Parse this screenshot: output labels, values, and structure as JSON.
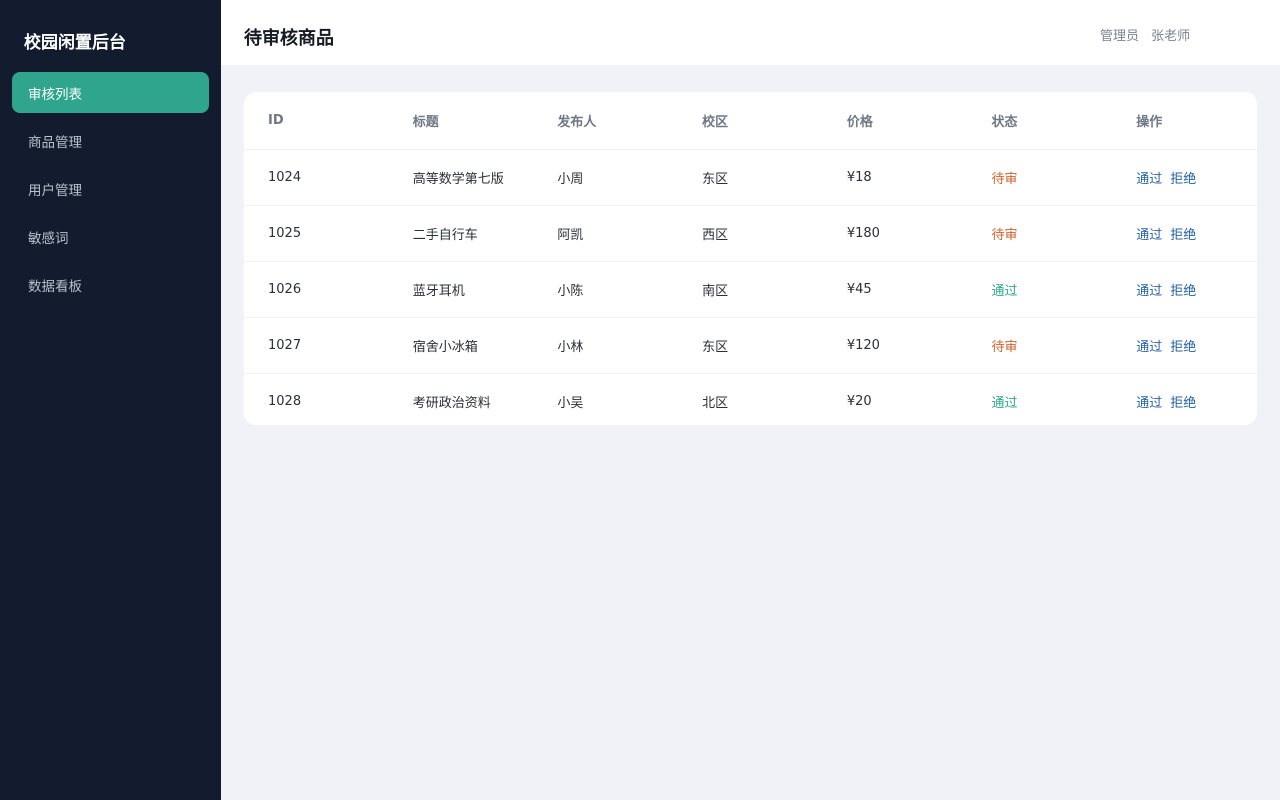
{
  "sidebar": {
    "brand": "校园闲置后台",
    "items": [
      {
        "label": "审核列表",
        "active": true
      },
      {
        "label": "商品管理",
        "active": false
      },
      {
        "label": "用户管理",
        "active": false
      },
      {
        "label": "敏感词",
        "active": false
      },
      {
        "label": "数据看板",
        "active": false
      }
    ]
  },
  "header": {
    "title": "待审核商品",
    "user_role": "管理员",
    "user_name": "张老师"
  },
  "table": {
    "columns": [
      "ID",
      "标题",
      "发布人",
      "校区",
      "价格",
      "状态",
      "操作"
    ],
    "rows": [
      {
        "id": "1024",
        "title": "高等数学第七版",
        "publisher": "小周",
        "campus": "东区",
        "price": "¥18",
        "status": "待审",
        "status_type": "pending"
      },
      {
        "id": "1025",
        "title": "二手自行车",
        "publisher": "阿凯",
        "campus": "西区",
        "price": "¥180",
        "status": "待审",
        "status_type": "pending"
      },
      {
        "id": "1026",
        "title": "蓝牙耳机",
        "publisher": "小陈",
        "campus": "南区",
        "price": "¥45",
        "status": "通过",
        "status_type": "approved"
      },
      {
        "id": "1027",
        "title": "宿舍小冰箱",
        "publisher": "小林",
        "campus": "东区",
        "price": "¥120",
        "status": "待审",
        "status_type": "pending"
      },
      {
        "id": "1028",
        "title": "考研政治资料",
        "publisher": "小吴",
        "campus": "北区",
        "price": "¥20",
        "status": "通过",
        "status_type": "approved"
      }
    ],
    "actions": {
      "approve": "通过",
      "reject": "拒绝"
    }
  },
  "colors": {
    "sidebar_bg": "#131c2e",
    "accent": "#2ea58c",
    "pending": "#d3612c",
    "link": "#2563a8"
  }
}
